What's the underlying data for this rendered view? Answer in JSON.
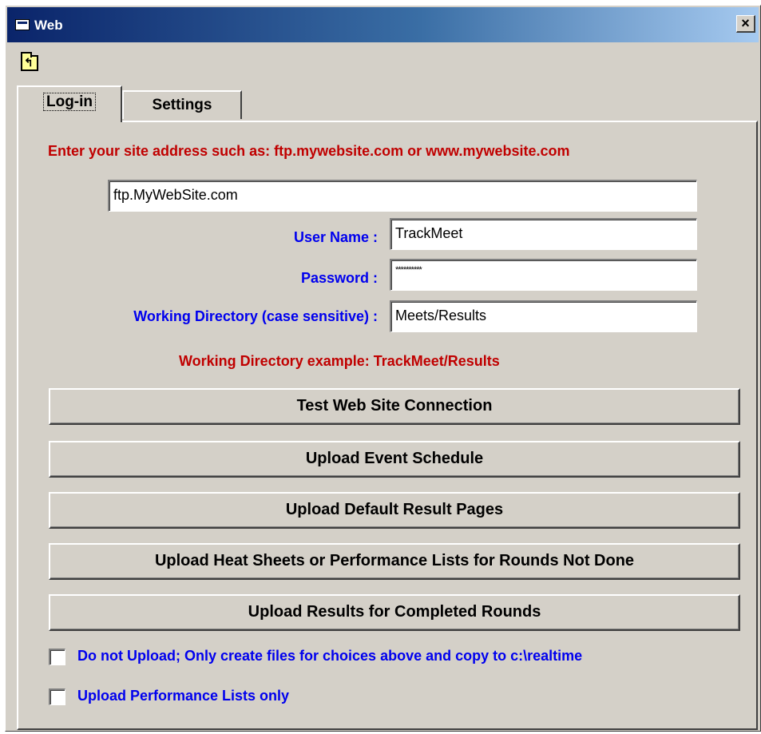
{
  "window": {
    "title": "Web",
    "close_label": "×"
  },
  "tabs": [
    {
      "label": "Log-in",
      "active": true
    },
    {
      "label": "Settings",
      "active": false
    }
  ],
  "login": {
    "hint": "Enter your site address such as:  ftp.mywebsite.com or www.mywebsite.com",
    "site_address": "ftp.MyWebSite.com",
    "username_label": "User Name :",
    "username_value": "TrackMeet",
    "password_label": "Password :",
    "password_value": "**********",
    "workdir_label": "Working Directory (case sensitive) :",
    "workdir_value": "Meets/Results",
    "workdir_example": "Working Directory example:  TrackMeet/Results"
  },
  "buttons": {
    "test_connection": "Test Web Site Connection",
    "upload_schedule": "Upload Event Schedule",
    "upload_default": "Upload Default Result Pages",
    "upload_heat": "Upload Heat Sheets or Performance Lists for Rounds Not Done",
    "upload_results": "Upload Results for Completed Rounds"
  },
  "options": {
    "no_upload": {
      "label": "Do not Upload; Only create files for choices above and copy to c:\\realtime",
      "checked": false
    },
    "perf_lists_only": {
      "label": "Upload Performance Lists only",
      "checked": false
    }
  },
  "colors": {
    "red_text": "#c00000",
    "blue_text": "#0000ee",
    "face": "#d4d0c8",
    "title_start": "#0a246a",
    "title_end": "#a6caf0"
  },
  "icons": {
    "app": "window-app-icon",
    "toolbar": "folder-up-icon",
    "close": "close-icon"
  }
}
